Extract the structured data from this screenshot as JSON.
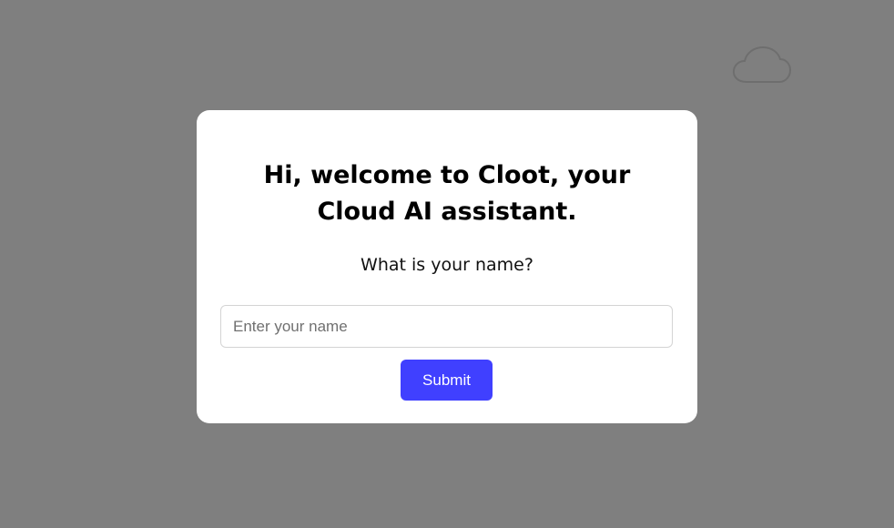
{
  "colors": {
    "backdrop": "#7f7f7f",
    "modal_background": "#ffffff",
    "accent": "#4040ff",
    "button_text": "#ffffff"
  },
  "background": {
    "icon": "cloud-icon"
  },
  "modal": {
    "title": "Hi, welcome to Cloot, your Cloud AI assistant.",
    "question": "What is your name?",
    "name_input": {
      "value": "",
      "placeholder": "Enter your name"
    },
    "submit_label": "Submit"
  }
}
